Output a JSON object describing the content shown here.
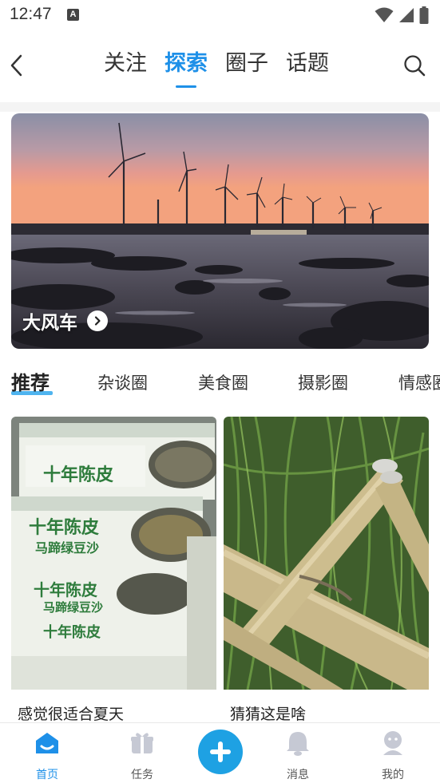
{
  "status_bar": {
    "time": "12:47",
    "notification_icon": "a-icon",
    "right_icons": [
      "wifi-icon",
      "cellular-signal-icon",
      "battery-icon"
    ]
  },
  "header": {
    "back_icon": "back-chevron-icon",
    "tabs": [
      {
        "label": "关注",
        "active": false
      },
      {
        "label": "探索",
        "active": true
      },
      {
        "label": "圈子",
        "active": false
      },
      {
        "label": "话题",
        "active": false
      }
    ],
    "search_icon": "search-icon"
  },
  "banner": {
    "title": "大风车",
    "arrow_icon": "chevron-right-icon"
  },
  "categories": [
    {
      "label": "推荐",
      "active": true
    },
    {
      "label": "杂谈圈",
      "active": false
    },
    {
      "label": "美食圈",
      "active": false
    },
    {
      "label": "摄影圈",
      "active": false
    },
    {
      "label": "情感圈",
      "active": false
    }
  ],
  "cards": [
    {
      "caption": "感觉很适合夏天",
      "box_text": "十年陈皮",
      "box_subtext": "马蹄绿豆沙"
    },
    {
      "caption": "猜猜这是啥"
    }
  ],
  "bottom_nav": {
    "items": [
      {
        "label": "首页",
        "icon": "home-icon",
        "active": true
      },
      {
        "label": "任务",
        "icon": "gift-icon",
        "active": false
      },
      {
        "label": "消息",
        "icon": "bell-icon",
        "active": false
      },
      {
        "label": "我的",
        "icon": "profile-icon",
        "active": false
      }
    ],
    "plus_icon": "plus-icon"
  },
  "colors": {
    "accent": "#1e90e8",
    "plus_button": "#1ea1e3",
    "category_underline": "#30a7ec"
  }
}
